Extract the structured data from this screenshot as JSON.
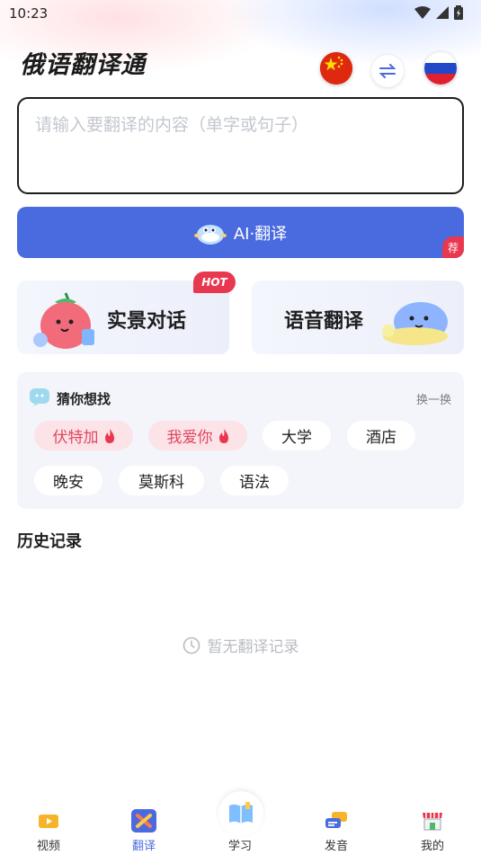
{
  "status_bar": {
    "time": "10:23"
  },
  "header": {
    "title": "俄语翻译通",
    "source_language_flag": "china-flag-icon",
    "target_language_flag": "russia-flag-icon",
    "swap_icon": "swap-arrows-icon"
  },
  "input": {
    "placeholder": "请输入要翻译的内容（单字或句子）",
    "value": ""
  },
  "ai_translate": {
    "label": "AI·翻译",
    "badge": "荐",
    "accent": "#4a6ae0"
  },
  "features": {
    "scene_dialog": {
      "label": "实景对话",
      "badge": "HOT"
    },
    "voice_translate": {
      "label": "语音翻译"
    }
  },
  "guess": {
    "title": "猜你想找",
    "refresh_label": "换一换",
    "chips": [
      {
        "label": "伏特加",
        "hot": true
      },
      {
        "label": "我爱你",
        "hot": true
      },
      {
        "label": "大学",
        "hot": false
      },
      {
        "label": "酒店",
        "hot": false
      },
      {
        "label": "晚安",
        "hot": false
      },
      {
        "label": "莫斯科",
        "hot": false
      },
      {
        "label": "语法",
        "hot": false
      }
    ]
  },
  "history": {
    "title": "历史记录",
    "empty_text": "暂无翻译记录"
  },
  "bottom_nav": {
    "items": [
      {
        "label": "视频",
        "icon": "video-icon"
      },
      {
        "label": "翻译",
        "icon": "translate-icon",
        "active": true
      },
      {
        "label": "学习",
        "icon": "book-icon"
      },
      {
        "label": "发音",
        "icon": "chat-bubbles-icon"
      },
      {
        "label": "我的",
        "icon": "shop-icon"
      }
    ]
  },
  "colors": {
    "accent": "#4a6ae0",
    "hot": "#e8384f"
  }
}
